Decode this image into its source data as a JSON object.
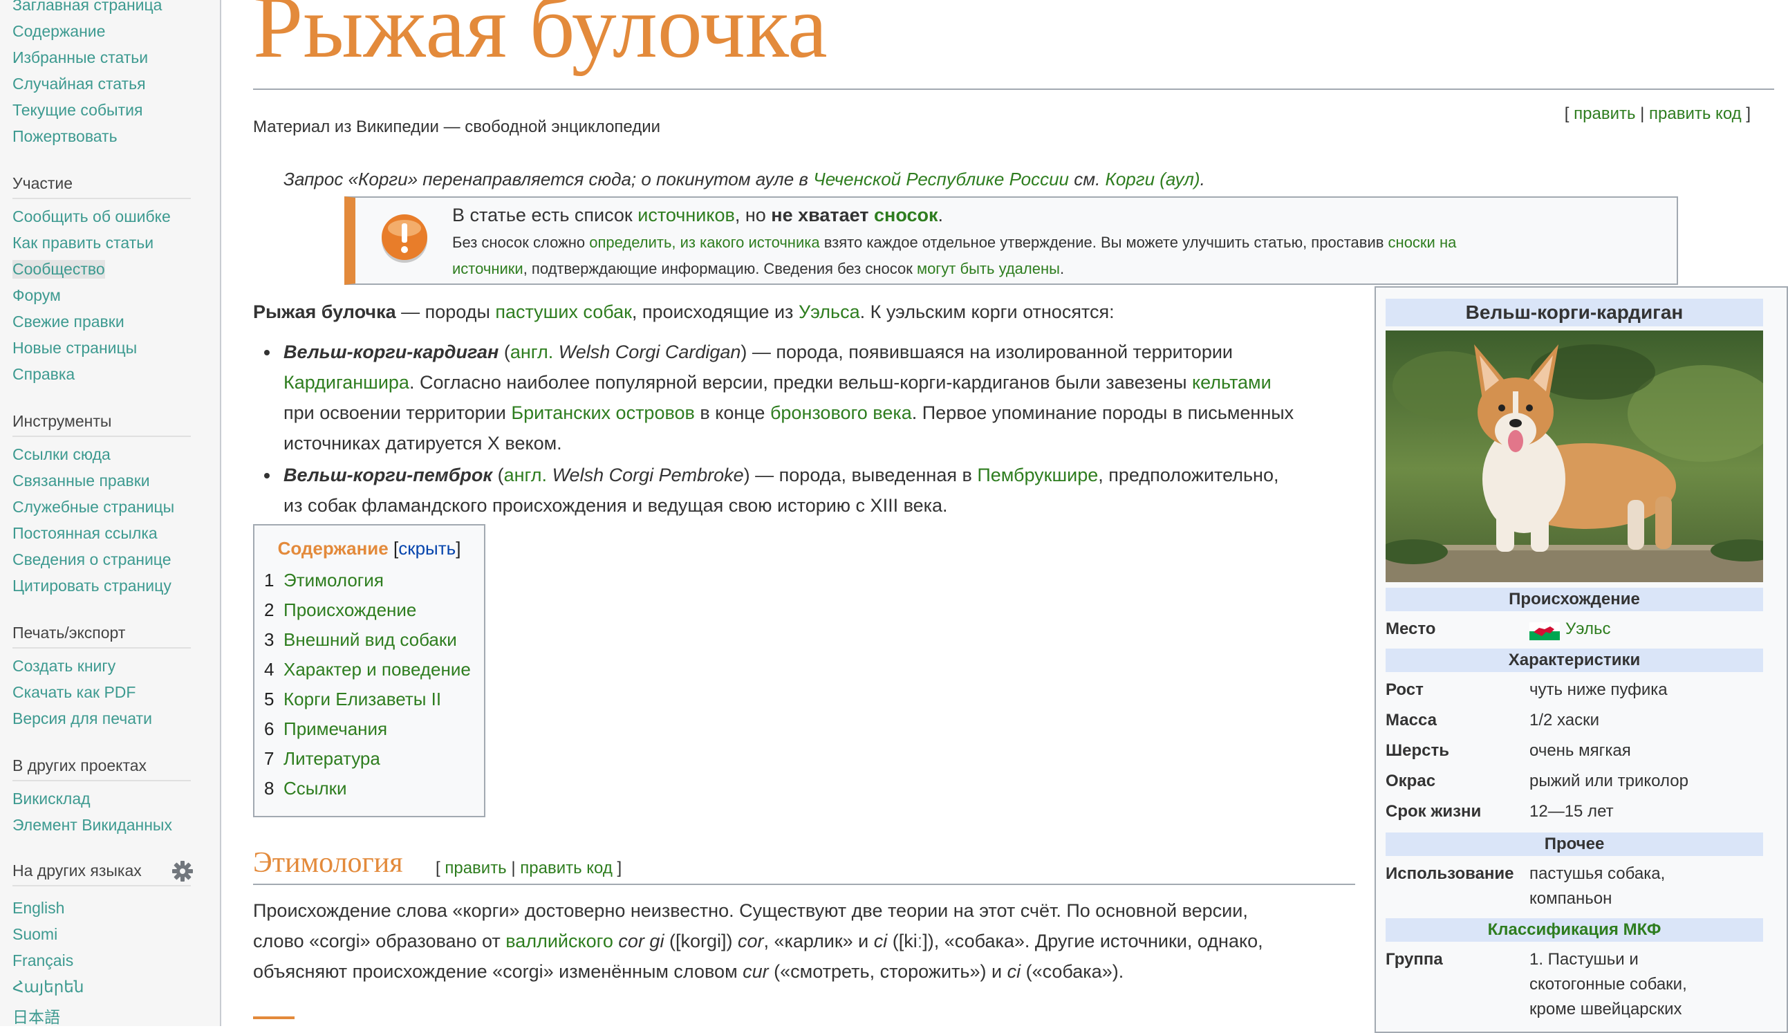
{
  "sidebar": {
    "nav": [
      "Заглавная страница",
      "Содержание",
      "Избранные статьи",
      "Случайная статья",
      "Текущие события",
      "Пожертвовать"
    ],
    "participation": {
      "heading": "Участие",
      "items": [
        "Сообщить об ошибке",
        "Как править статьи",
        "Сообщество",
        "Форум",
        "Свежие правки",
        "Новые страницы",
        "Справка"
      ]
    },
    "tools": {
      "heading": "Инструменты",
      "items": [
        "Ссылки сюда",
        "Связанные правки",
        "Служебные страницы",
        "Постоянная ссылка",
        "Сведения о странице",
        "Цитировать страницу"
      ]
    },
    "print": {
      "heading": "Печать/экспорт",
      "items": [
        "Создать книгу",
        "Скачать как PDF",
        "Версия для печати"
      ]
    },
    "projects": {
      "heading": "В других проектах",
      "items": [
        "Викисклад",
        "Элемент Викиданных"
      ]
    },
    "languages": {
      "heading": "На других языках",
      "items": [
        "English",
        "Suomi",
        "Français",
        "Հայերեն",
        "日本語"
      ]
    }
  },
  "article": {
    "title": "Рыжая булочка",
    "subtitle": "Материал из Википедии — свободной энциклопедии",
    "edit": {
      "open": "[ ",
      "edit": "править",
      "sep": " | ",
      "edit_code": "править код",
      "close": " ]"
    },
    "hatnote": {
      "t1": "Запрос «Корги» перенаправляется сюда; о покинутом ауле в ",
      "l1": "Чеченской Республике России",
      "t2": " см. ",
      "l2": "Корги (аул)",
      "t3": "."
    },
    "ambox": {
      "l1": {
        "t1": "В статье есть список ",
        "l1": "источников",
        "t2": ", но ",
        "b1": "не хватает",
        "t3": " ",
        "l2": "сносок",
        "t4": "."
      },
      "l2": {
        "t1": "Без сносок сложно ",
        "l1": "определить, из какого источника",
        "t2": " взято каждое отдельное утверждение. Вы можете улучшить статью, проставив ",
        "l2": "сноски на"
      },
      "l3": {
        "l1": "источники",
        "t1": ", подтверждающие информацию. Сведения без сносок ",
        "l2": "могут быть удалены",
        "t2": "."
      }
    },
    "intro": {
      "b1": "Рыжая булочка",
      "t1": " — породы ",
      "l1": "пастуших собак",
      "t2": ", происходящие из ",
      "l2": "Уэльса",
      "t3": ". К уэльским корги относятся:"
    },
    "bullet1": {
      "l1a": {
        "bi": "Вельш-корги-кардиган",
        "t1": " (",
        "l1": "англ.",
        "t2": " ",
        "i1": "Welsh Corgi Cardigan",
        "t3": ") — порода, появившаяся на изолированной территории"
      },
      "l1b": {
        "l1": "Кардиганшира",
        "t1": ". Согласно наиболее популярной версии, предки вельш-корги-кардиганов были завезены ",
        "l2": "кельтами"
      },
      "l1c": {
        "t1": "при освоении территории ",
        "l1": "Британских островов",
        "t2": " в конце ",
        "l2": "бронзового века",
        "t3": ". Первое упоминание породы в письменных"
      },
      "l1d": "источниках датируется X веком."
    },
    "bullet2": {
      "l2a": {
        "bi": "Вельш-корги-пемброк",
        "t1": " (",
        "l1": "англ.",
        "t2": " ",
        "i1": "Welsh Corgi Pembroke",
        "t3": ") — порода, выведенная в ",
        "l2": "Пембрукшире",
        "t4": ", предположительно,"
      },
      "l2b": "из собак фламандского происхождения и ведущая свою историю с XIII века."
    },
    "toc": {
      "title": "Содержание",
      "toggle_open": " [",
      "toggle": "скрыть",
      "toggle_close": "]",
      "items": [
        {
          "num": "1",
          "label": "Этимология"
        },
        {
          "num": "2",
          "label": "Происхождение"
        },
        {
          "num": "3",
          "label": "Внешний вид собаки"
        },
        {
          "num": "4",
          "label": "Характер и поведение"
        },
        {
          "num": "5",
          "label": "Корги Елизаветы II"
        },
        {
          "num": "6",
          "label": "Примечания"
        },
        {
          "num": "7",
          "label": "Литература"
        },
        {
          "num": "8",
          "label": "Ссылки"
        }
      ]
    },
    "section1": {
      "title": "Этимология",
      "p1": "Происхождение слова «корги» достоверно неизвестно. Существуют две теории на этот счёт. По основной версии,",
      "p2": {
        "t1": "слово «corgi» образовано от ",
        "l1": "валлийского",
        "t2": " ",
        "i1": "cor gi",
        "t3": " ([korgi]) ",
        "i2": "cor",
        "t4": ", «карлик» и ",
        "i3": "ci",
        "t5": " ([kiː]), «собака». Другие источники, однако,"
      },
      "p3": {
        "t1": "объясняют происхождение «corgi» изменённым словом ",
        "i1": "cur",
        "t2": " («смотреть, сторожить») и ",
        "i2": "ci",
        "t3": " («собака»)."
      }
    },
    "infobox": {
      "title": "Вельш-корги-кардиган",
      "origin_head": "Происхождение",
      "place_label": "Место",
      "place_value": "Уэльс",
      "char_head": "Характеристики",
      "rows": [
        {
          "label": "Рост",
          "value": "чуть ниже пуфика"
        },
        {
          "label": "Масса",
          "value": "1/2 хаски"
        },
        {
          "label": "Шерсть",
          "value": "очень мягкая"
        },
        {
          "label": "Окрас",
          "value": "рыжий или триколор"
        },
        {
          "label": "Срок жизни",
          "value": "12—15 лет"
        }
      ],
      "other_head": "Прочее",
      "use_label": "Использование",
      "use_value_1": "пастушья собака,",
      "use_value_2": "компаньон",
      "fci_head": "Классификация МКФ",
      "group_label": "Группа",
      "group_value_1": "1. Пастушьи и",
      "group_value_2": "скотогонные собаки,",
      "group_value_3": "кроме швейцарских"
    }
  },
  "colors": {
    "link": "#2e7d1f",
    "sidebar_link": "#3d9a90",
    "title": "#e38a3b",
    "infobox_head": "#dae5f8",
    "toc_toggle": "#0645ad"
  }
}
